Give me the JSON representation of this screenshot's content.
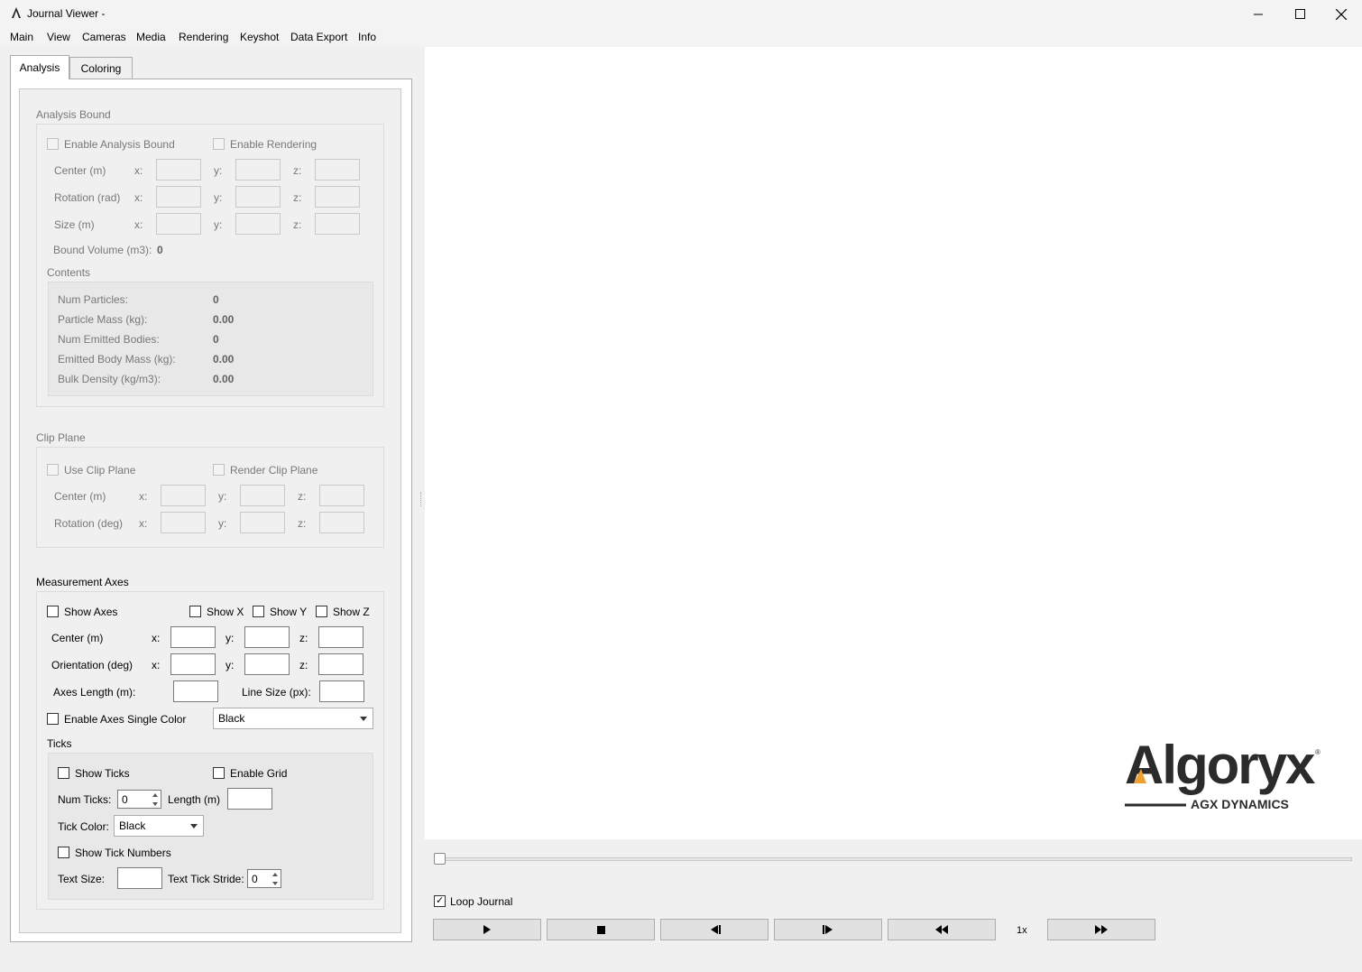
{
  "window": {
    "title": "Journal Viewer -"
  },
  "menu": [
    "Main",
    "View",
    "Cameras",
    "Media",
    "Rendering",
    "Keyshot",
    "Data Export",
    "Info"
  ],
  "tabs": [
    "Analysis",
    "Coloring"
  ],
  "analysis_bound": {
    "title": "Analysis Bound",
    "enable_label": "Enable Analysis Bound",
    "render_label": "Enable Rendering",
    "rows": [
      "Center (m)",
      "Rotation (rad)",
      "Size (m)"
    ],
    "axis_x": "x:",
    "axis_y": "y:",
    "axis_z": "z:",
    "volume_label": "Bound Volume (m3):",
    "volume_value": "0",
    "contents_title": "Contents",
    "contents": [
      {
        "label": "Num Particles:",
        "value": "0"
      },
      {
        "label": "Particle Mass (kg):",
        "value": "0.00"
      },
      {
        "label": "Num Emitted Bodies:",
        "value": "0"
      },
      {
        "label": "Emitted Body Mass (kg):",
        "value": "0.00"
      },
      {
        "label": "Bulk Density (kg/m3):",
        "value": "0.00"
      }
    ]
  },
  "clip_plane": {
    "title": "Clip Plane",
    "use_label": "Use Clip Plane",
    "render_label": "Render Clip Plane",
    "rows": [
      "Center (m)",
      "Rotation (deg)"
    ]
  },
  "measurement_axes": {
    "title": "Measurement Axes",
    "show_axes": "Show Axes",
    "show_x": "Show X",
    "show_y": "Show Y",
    "show_z": "Show Z",
    "rows": [
      "Center (m)",
      "Orientation (deg)"
    ],
    "axes_length_label": "Axes Length (m):",
    "line_size_label": "Line Size (px):",
    "single_color_label": "Enable Axes Single Color",
    "single_color_value": "Black",
    "ticks": {
      "title": "Ticks",
      "show_ticks": "Show Ticks",
      "enable_grid": "Enable Grid",
      "num_ticks_label": "Num Ticks:",
      "num_ticks_value": "0",
      "length_label": "Length (m)",
      "tick_color_label": "Tick Color:",
      "tick_color_value": "Black",
      "show_tick_numbers": "Show Tick Numbers",
      "text_size_label": "Text Size:",
      "text_stride_label": "Text Tick Stride:",
      "text_stride_value": "0"
    }
  },
  "logo": {
    "brand": "Algoryx",
    "sub": "AGX DYNAMICS"
  },
  "playback": {
    "loop_label": "Loop Journal",
    "loop_checked": true,
    "speed": "1x",
    "progress": 0
  }
}
